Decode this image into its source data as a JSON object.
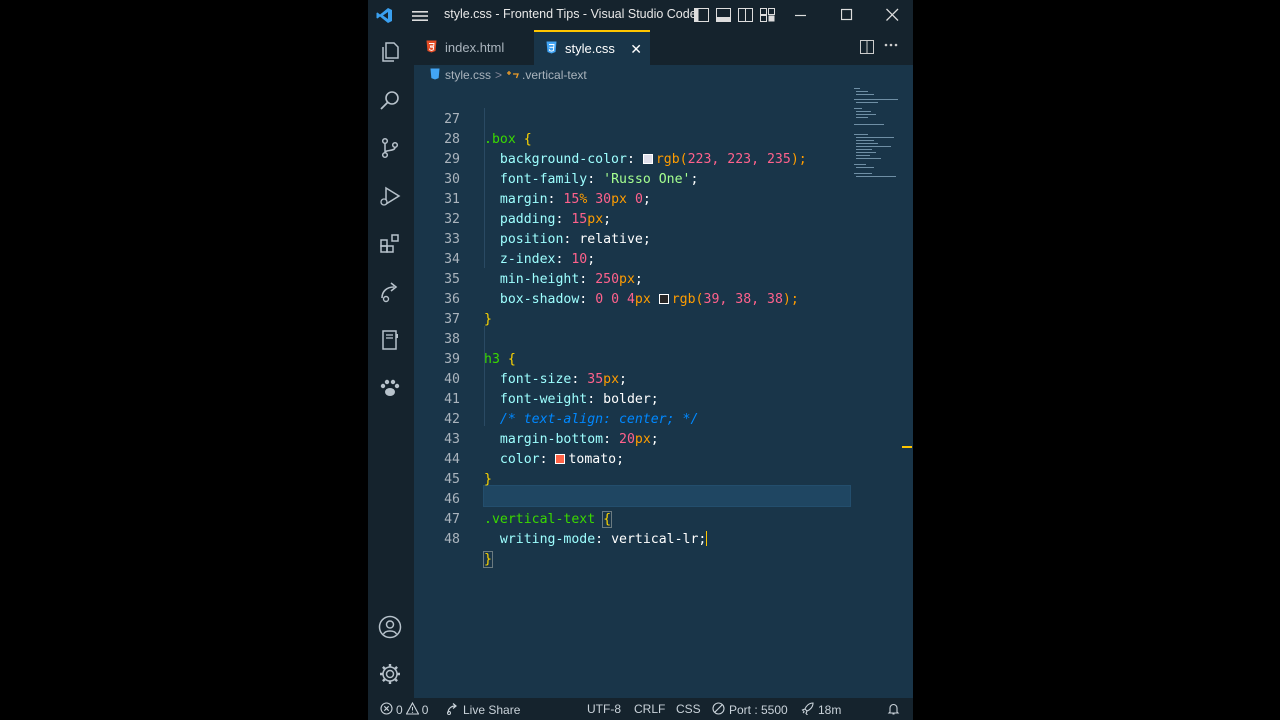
{
  "window": {
    "title": "style.css - Frontend Tips - Visual Studio Code",
    "accent": "#ffc600",
    "background": "#193549",
    "chrome": "#15232d"
  },
  "titlebar_icons": [
    "vscode-logo-icon",
    "menu-icon",
    "toggle-sidebar-icon",
    "toggle-panel-icon",
    "toggle-secondary-sidebar-icon",
    "customize-layout-icon",
    "minimize-icon",
    "maximize-icon",
    "close-icon"
  ],
  "activity_bar": [
    "explorer-icon",
    "search-icon",
    "source-control-icon",
    "run-debug-icon",
    "extensions-icon",
    "remote-explorer-icon",
    "notebook-icon",
    "paw-icon",
    "account-icon",
    "settings-gear-icon"
  ],
  "tabs": [
    {
      "label": "index.html",
      "icon": "html5-icon",
      "active": false
    },
    {
      "label": "style.css",
      "icon": "css3-icon",
      "active": true,
      "close": "✕"
    }
  ],
  "editor_actions": [
    "split-editor-icon",
    "more-actions-icon"
  ],
  "breadcrumb": {
    "file": "style.css",
    "separator": ">",
    "symbol": ".vertical-text"
  },
  "editor": {
    "line_numbers": [
      "27",
      "28",
      "29",
      "30",
      "31",
      "32",
      "33",
      "34",
      "35",
      "36",
      "37",
      "38",
      "39",
      "40",
      "41",
      "42",
      "43",
      "44",
      "45",
      "46",
      "47",
      "48"
    ],
    "code": {
      "l27_sel": ".box",
      "l27_brace": " {",
      "l28_prop": "background-color",
      "l28_fn": "rgb(",
      "l28_args": "223, 223, 235",
      "l28_close": ");",
      "l28_swatch": "#dfdfeb",
      "l29_prop": "font-family",
      "l29_str": "'Russo One'",
      "l30_prop": "margin",
      "l30_n1": "15",
      "l30_u1": "%",
      "l30_n2": "30",
      "l30_u2": "px",
      "l30_n3": "0",
      "l31_prop": "padding",
      "l31_n": "15",
      "l31_u": "px",
      "l32_prop": "position",
      "l32_val": "relative",
      "l33_prop": "z-index",
      "l33_n": "10",
      "l34_prop": "min-height",
      "l34_n": "250",
      "l34_u": "px",
      "l35_prop": "box-shadow",
      "l35_n1": "0 0 4",
      "l35_u": "px",
      "l35_fn": "rgb(",
      "l35_args": "39, 38, 38",
      "l35_close": ");",
      "l35_swatch": "#272626",
      "l36": "}",
      "l38_sel": "h3",
      "l38_brace": " {",
      "l39_prop": "font-size",
      "l39_n": "35",
      "l39_u": "px",
      "l40_prop": "font-weight",
      "l40_val": "bolder",
      "l41_cmt": "/* text-align: center; */",
      "l42_prop": "margin-bottom",
      "l42_n": "20",
      "l42_u": "px",
      "l43_prop": "color",
      "l43_val": "tomato",
      "l43_swatch": "#ff6347",
      "l44": "}",
      "l46_sel": ".vertical-text",
      "l46_brace": "{",
      "l47_prop": "writing-mode",
      "l47_val": "vertical-lr",
      "l48": "}"
    }
  },
  "statusbar": {
    "errors": "0",
    "warnings": "0",
    "live_share": "Live Share",
    "encoding": "UTF-8",
    "eol": "CRLF",
    "language": "CSS",
    "port": "Port : 5500",
    "time": "18m"
  }
}
